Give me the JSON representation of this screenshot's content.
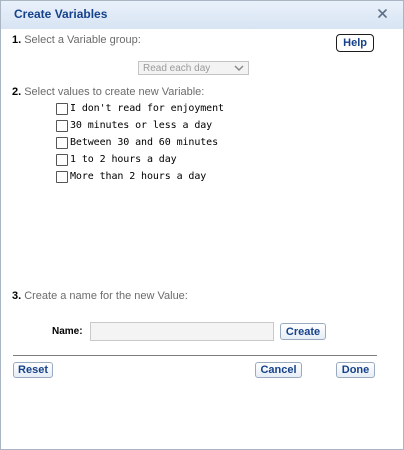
{
  "window": {
    "title": "Create Variables",
    "close_icon": "close-icon"
  },
  "step1": {
    "number": "1.",
    "label": "Select a Variable group:",
    "help_label": "Help",
    "select_value": "Read each day"
  },
  "step2": {
    "number": "2.",
    "label": "Select values to create new Variable:",
    "options": [
      {
        "label": "I don't read for enjoyment",
        "checked": false
      },
      {
        "label": "30 minutes or less a day",
        "checked": false
      },
      {
        "label": "Between 30 and 60 minutes",
        "checked": false
      },
      {
        "label": "1 to 2 hours a day",
        "checked": false
      },
      {
        "label": "More than 2 hours a day",
        "checked": false
      }
    ]
  },
  "step3": {
    "number": "3.",
    "label": "Create a name for the new Value:",
    "name_label": "Name:",
    "name_value": "",
    "create_label": "Create"
  },
  "footer": {
    "reset_label": "Reset",
    "cancel_label": "Cancel",
    "done_label": "Done"
  },
  "colors": {
    "title_text": "#15428b",
    "button_text": "#15428b"
  }
}
